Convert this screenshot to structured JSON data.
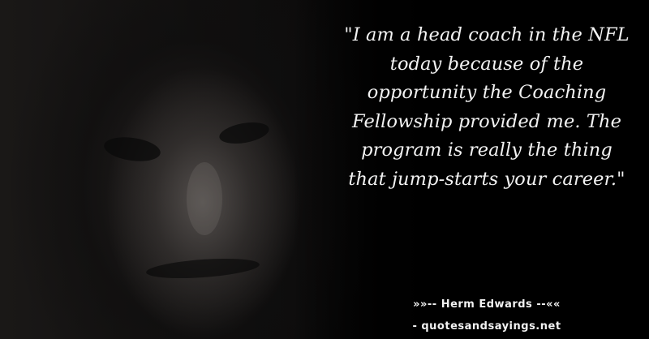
{
  "quote": {
    "text": "\"I am a head coach in the NFL today because of the opportunity the Coaching Fellowship provided me. The program is really the thing that jump-starts your career.\""
  },
  "attribution": {
    "author_line": "»»-- Herm Edwards --««",
    "source_line": "- quotesandsayings.net"
  },
  "colors": {
    "background": "#000000",
    "text": "#f2f2f2"
  }
}
